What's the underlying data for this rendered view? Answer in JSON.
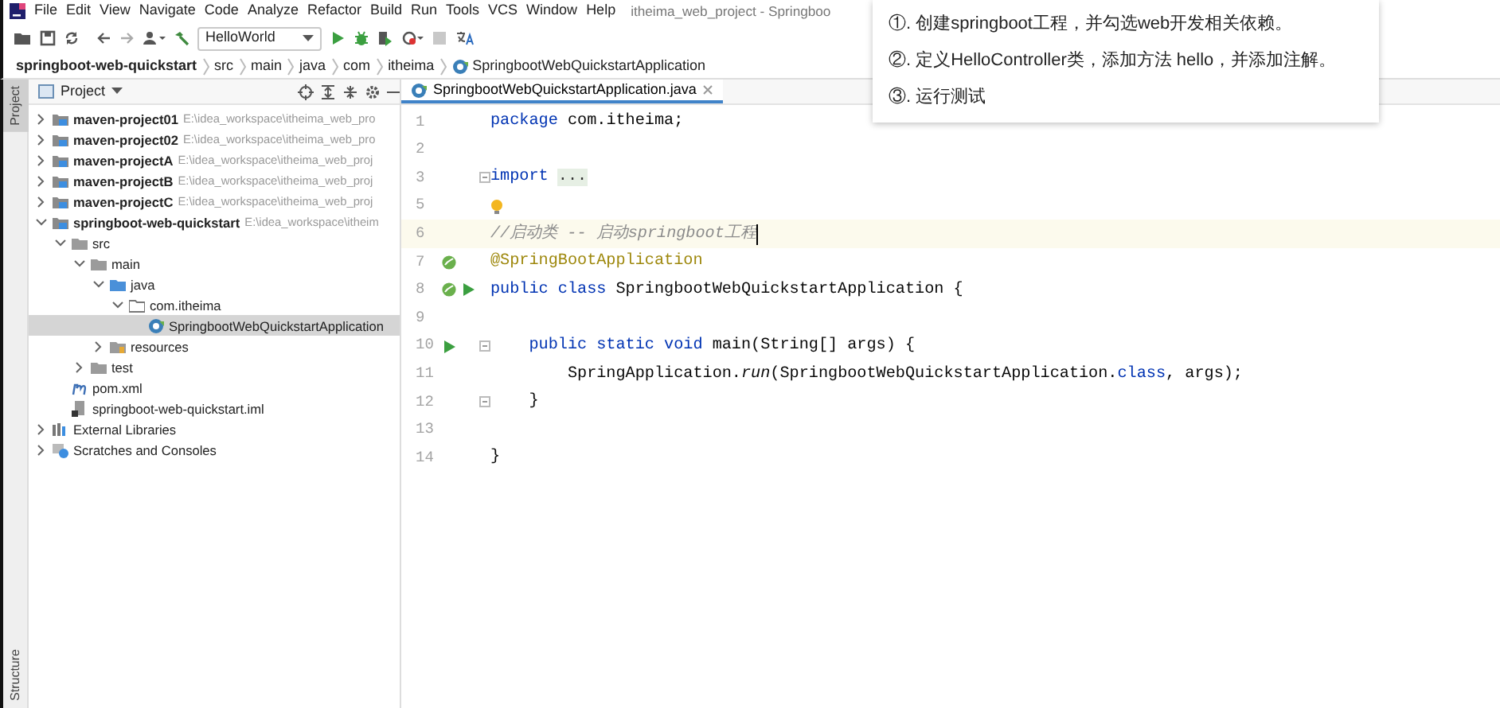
{
  "menu_bar": {
    "items": [
      "File",
      "Edit",
      "View",
      "Navigate",
      "Code",
      "Analyze",
      "Refactor",
      "Build",
      "Run",
      "Tools",
      "VCS",
      "Window",
      "Help"
    ],
    "title": "itheima_web_project - Springboo"
  },
  "toolbar": {
    "run_configuration": "HelloWorld"
  },
  "breadcrumb": [
    "springboot-web-quickstart",
    "src",
    "main",
    "java",
    "com",
    "itheima",
    "SpringbootWebQuickstartApplication"
  ],
  "side_tabs": [
    {
      "label": "Project",
      "selected": true
    },
    {
      "label": "Structure",
      "selected": false
    }
  ],
  "project_panel": {
    "title": "Project",
    "tree": [
      {
        "kind": "module",
        "name": "maven-project01",
        "path": "E:\\idea_workspace\\itheima_web_pro",
        "expanded": false,
        "selected": false
      },
      {
        "kind": "module",
        "name": "maven-project02",
        "path": "E:\\idea_workspace\\itheima_web_pro",
        "expanded": false,
        "selected": false
      },
      {
        "kind": "module",
        "name": "maven-projectA",
        "path": "E:\\idea_workspace\\itheima_web_proj",
        "expanded": false,
        "selected": false
      },
      {
        "kind": "module",
        "name": "maven-projectB",
        "path": "E:\\idea_workspace\\itheima_web_proj",
        "expanded": false,
        "selected": false
      },
      {
        "kind": "module",
        "name": "maven-projectC",
        "path": "E:\\idea_workspace\\itheima_web_proj",
        "expanded": false,
        "selected": false
      },
      {
        "kind": "module",
        "name": "springboot-web-quickstart",
        "path": "E:\\idea_workspace\\itheim",
        "expanded": true,
        "selected": false,
        "children": [
          {
            "kind": "folder",
            "name": "src",
            "expanded": true,
            "selected": false,
            "children": [
              {
                "kind": "folder",
                "name": "main",
                "expanded": true,
                "selected": false,
                "children": [
                  {
                    "kind": "source",
                    "name": "java",
                    "expanded": true,
                    "selected": false,
                    "children": [
                      {
                        "kind": "package",
                        "name": "com.itheima",
                        "expanded": true,
                        "selected": false,
                        "children": [
                          {
                            "kind": "class",
                            "name": "SpringbootWebQuickstartApplication",
                            "selected": true
                          }
                        ]
                      }
                    ]
                  },
                  {
                    "kind": "resources",
                    "name": "resources",
                    "expanded": false,
                    "selected": false
                  }
                ]
              },
              {
                "kind": "folder",
                "name": "test",
                "expanded": false,
                "selected": false
              }
            ]
          },
          {
            "kind": "pom",
            "name": "pom.xml",
            "selected": false
          },
          {
            "kind": "iml",
            "name": "springboot-web-quickstart.iml",
            "selected": false
          }
        ]
      },
      {
        "kind": "libraries",
        "name": "External Libraries",
        "expanded": false,
        "selected": false
      },
      {
        "kind": "scratches",
        "name": "Scratches and Consoles",
        "expanded": false,
        "selected": false
      }
    ]
  },
  "editor": {
    "tabs": [
      {
        "label": "SpringbootWebQuickstartApplication.java",
        "selected": true
      }
    ],
    "lines": [
      {
        "number": "1",
        "tokens": [
          {
            "kind": "keyword",
            "text": "package"
          },
          {
            "kind": "plain",
            "text": " com.itheima;"
          }
        ]
      },
      {
        "number": "2"
      },
      {
        "number": "3",
        "fold": true,
        "tokens": [
          {
            "kind": "keyword",
            "text": "import "
          },
          {
            "kind": "folded",
            "text": "..."
          }
        ]
      },
      {
        "number": "5",
        "bulb": true
      },
      {
        "number": "6",
        "current": true,
        "tokens": [
          {
            "kind": "comment",
            "text": "//启动类 -- 启动springboot工程"
          }
        ]
      },
      {
        "number": "7",
        "bean": true,
        "tokens": [
          {
            "kind": "annotation",
            "text": "@SpringBootApplication"
          }
        ]
      },
      {
        "number": "8",
        "bean": true,
        "run": true,
        "tokens": [
          {
            "kind": "keyword",
            "text": "public class"
          },
          {
            "kind": "plain",
            "text": " SpringbootWebQuickstartApplication {"
          }
        ]
      },
      {
        "number": "9"
      },
      {
        "number": "10",
        "run": true,
        "fold": true,
        "tokens": [
          {
            "kind": "keyword",
            "text": "    public static void"
          },
          {
            "kind": "plain",
            "text": " main(String[] args) {"
          }
        ]
      },
      {
        "number": "11",
        "tokens": [
          {
            "kind": "plain",
            "text": "        SpringApplication."
          },
          {
            "kind": "method",
            "text": "run"
          },
          {
            "kind": "plain",
            "text": "(SpringbootWebQuickstartApplication."
          },
          {
            "kind": "keyword",
            "text": "class"
          },
          {
            "kind": "plain",
            "text": ", args);"
          }
        ]
      },
      {
        "number": "12",
        "fold": true,
        "tokens": [
          {
            "kind": "plain",
            "text": "    }"
          }
        ]
      },
      {
        "number": "13"
      },
      {
        "number": "14",
        "tokens": [
          {
            "kind": "plain",
            "text": "}"
          }
        ]
      }
    ]
  },
  "popup": {
    "items": [
      "①. 创建springboot工程，并勾选web开发相关依赖。",
      "②. 定义HelloController类，添加方法 hello，并添加注解。",
      "③. 运行测试"
    ]
  }
}
